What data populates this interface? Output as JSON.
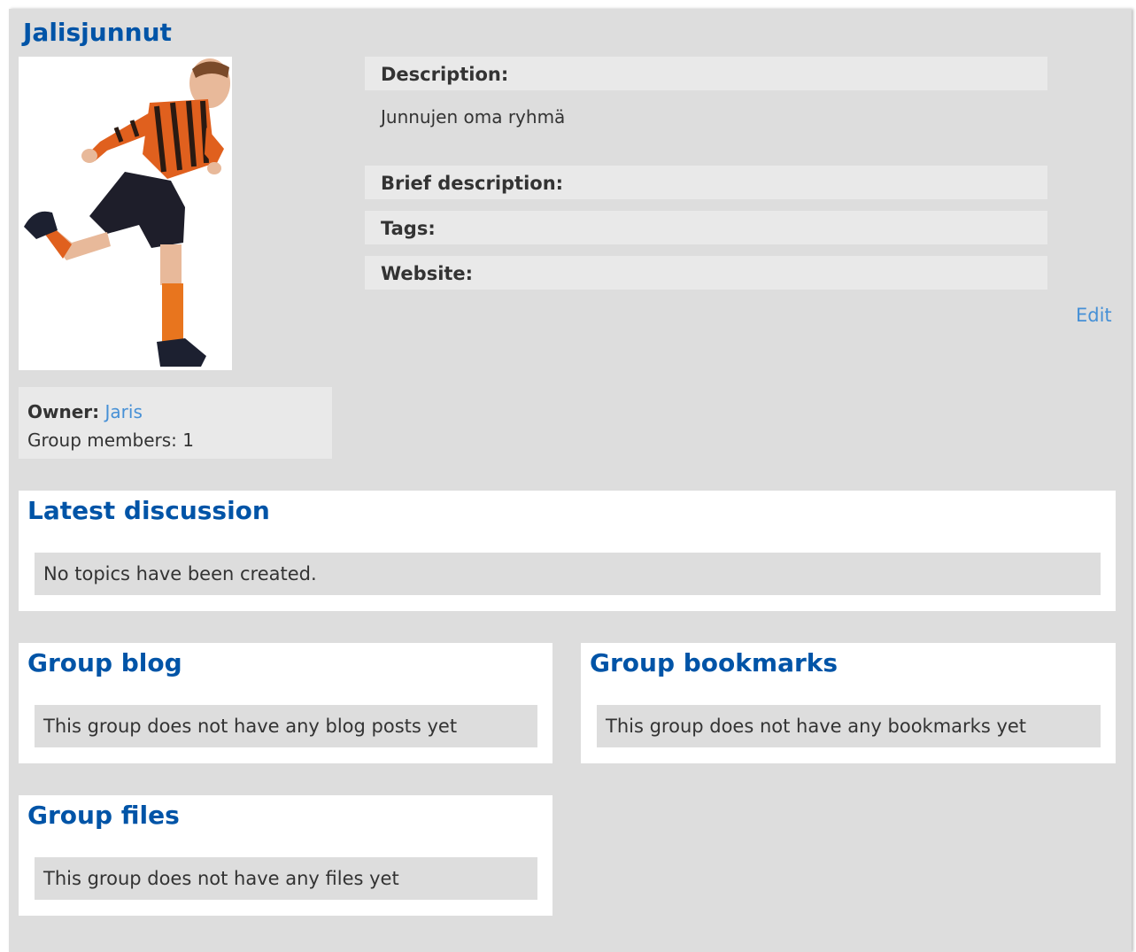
{
  "group": {
    "title": "Jalisjunnut",
    "owner_label": "Owner:",
    "owner_name": "Jaris",
    "members_text": "Group members: 1",
    "edit_label": "Edit"
  },
  "profile_fields": {
    "description_label": "Description:",
    "description_value": "Junnujen oma ryhmä",
    "brief_label": "Brief description:",
    "tags_label": "Tags:",
    "website_label": "Website:"
  },
  "discussion": {
    "title": "Latest discussion",
    "empty_text": "No topics have been created."
  },
  "blog": {
    "title": "Group blog",
    "empty_text": "This group does not have any blog posts yet"
  },
  "bookmarks": {
    "title": "Group bookmarks",
    "empty_text": "This group does not have any bookmarks yet"
  },
  "files": {
    "title": "Group files",
    "empty_text": "This group does not have any files yet"
  },
  "colors": {
    "title_blue": "#0054a7",
    "link_blue": "#4690d6",
    "panel_bg": "#ffffff",
    "page_bg": "#dddddd"
  },
  "icons": {
    "avatar": "group-avatar-soccer-kid"
  }
}
